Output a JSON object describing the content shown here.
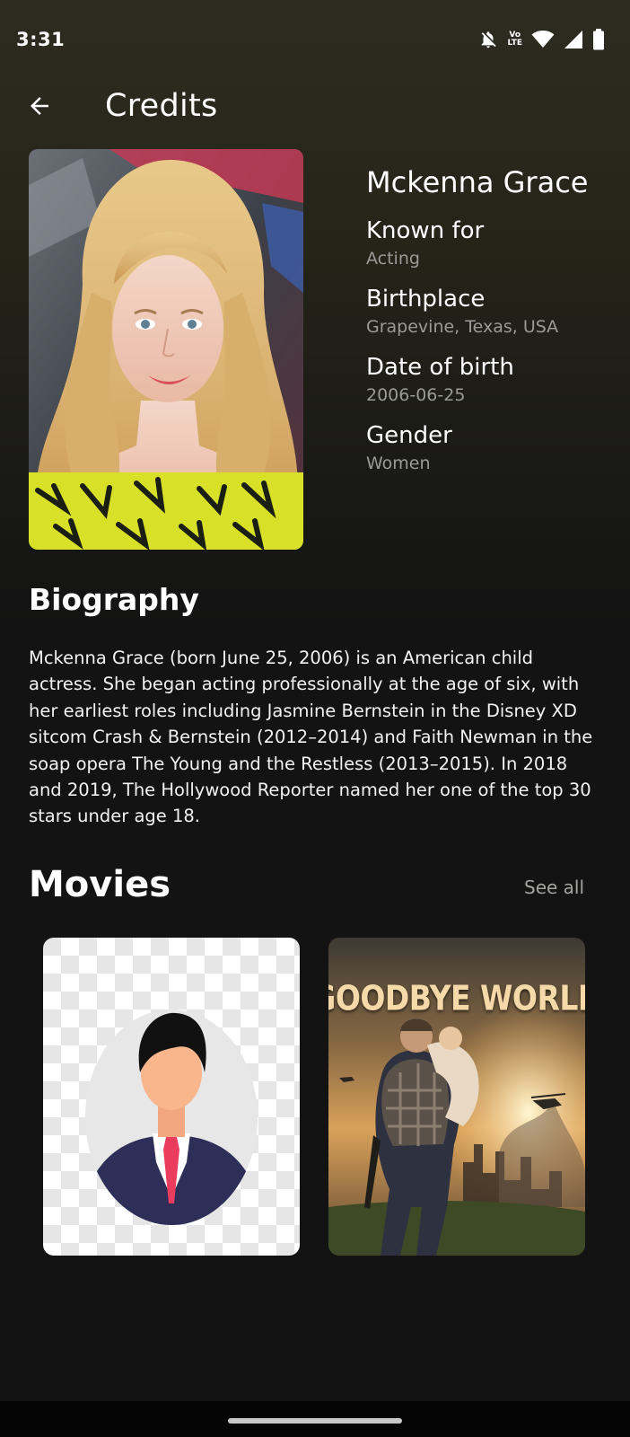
{
  "status_bar": {
    "time": "3:31",
    "icons": [
      "bell-off-icon",
      "volte-icon",
      "wifi-icon",
      "signal-icon",
      "battery-icon"
    ],
    "volte_top": "Vo",
    "volte_bottom": "LTE"
  },
  "app_bar": {
    "back_icon": "arrow-back-icon",
    "title": "Credits"
  },
  "profile": {
    "name": "Mckenna Grace",
    "fields": [
      {
        "label": "Known for",
        "value": "Acting"
      },
      {
        "label": "Birthplace",
        "value": "Grapevine, Texas, USA"
      },
      {
        "label": "Date of birth",
        "value": "2006-06-25"
      },
      {
        "label": "Gender",
        "value": "Women"
      }
    ]
  },
  "biography": {
    "title": "Biography",
    "text": "Mckenna Grace (born June 25, 2006) is an American child actress. She began acting professionally at the age of six, with her earliest roles including Jasmine Bernstein in the Disney XD sitcom Crash & Bernstein (2012–2014) and Faith Newman in the soap opera The Young and the Restless (2013–2015). In 2018 and 2019, The Hollywood Reporter named her one of the top 30 stars under age 18."
  },
  "movies": {
    "title": "Movies",
    "see_all": "See all",
    "items": [
      {
        "poster": "placeholder-avatar-icon"
      },
      {
        "poster_title": "GOODBYE WORLD"
      }
    ]
  },
  "colors": {
    "background_top": "#2d2c20",
    "background_bottom": "#131313",
    "muted_text": "#9a9a96",
    "poster_title": "#f6d9a8"
  }
}
